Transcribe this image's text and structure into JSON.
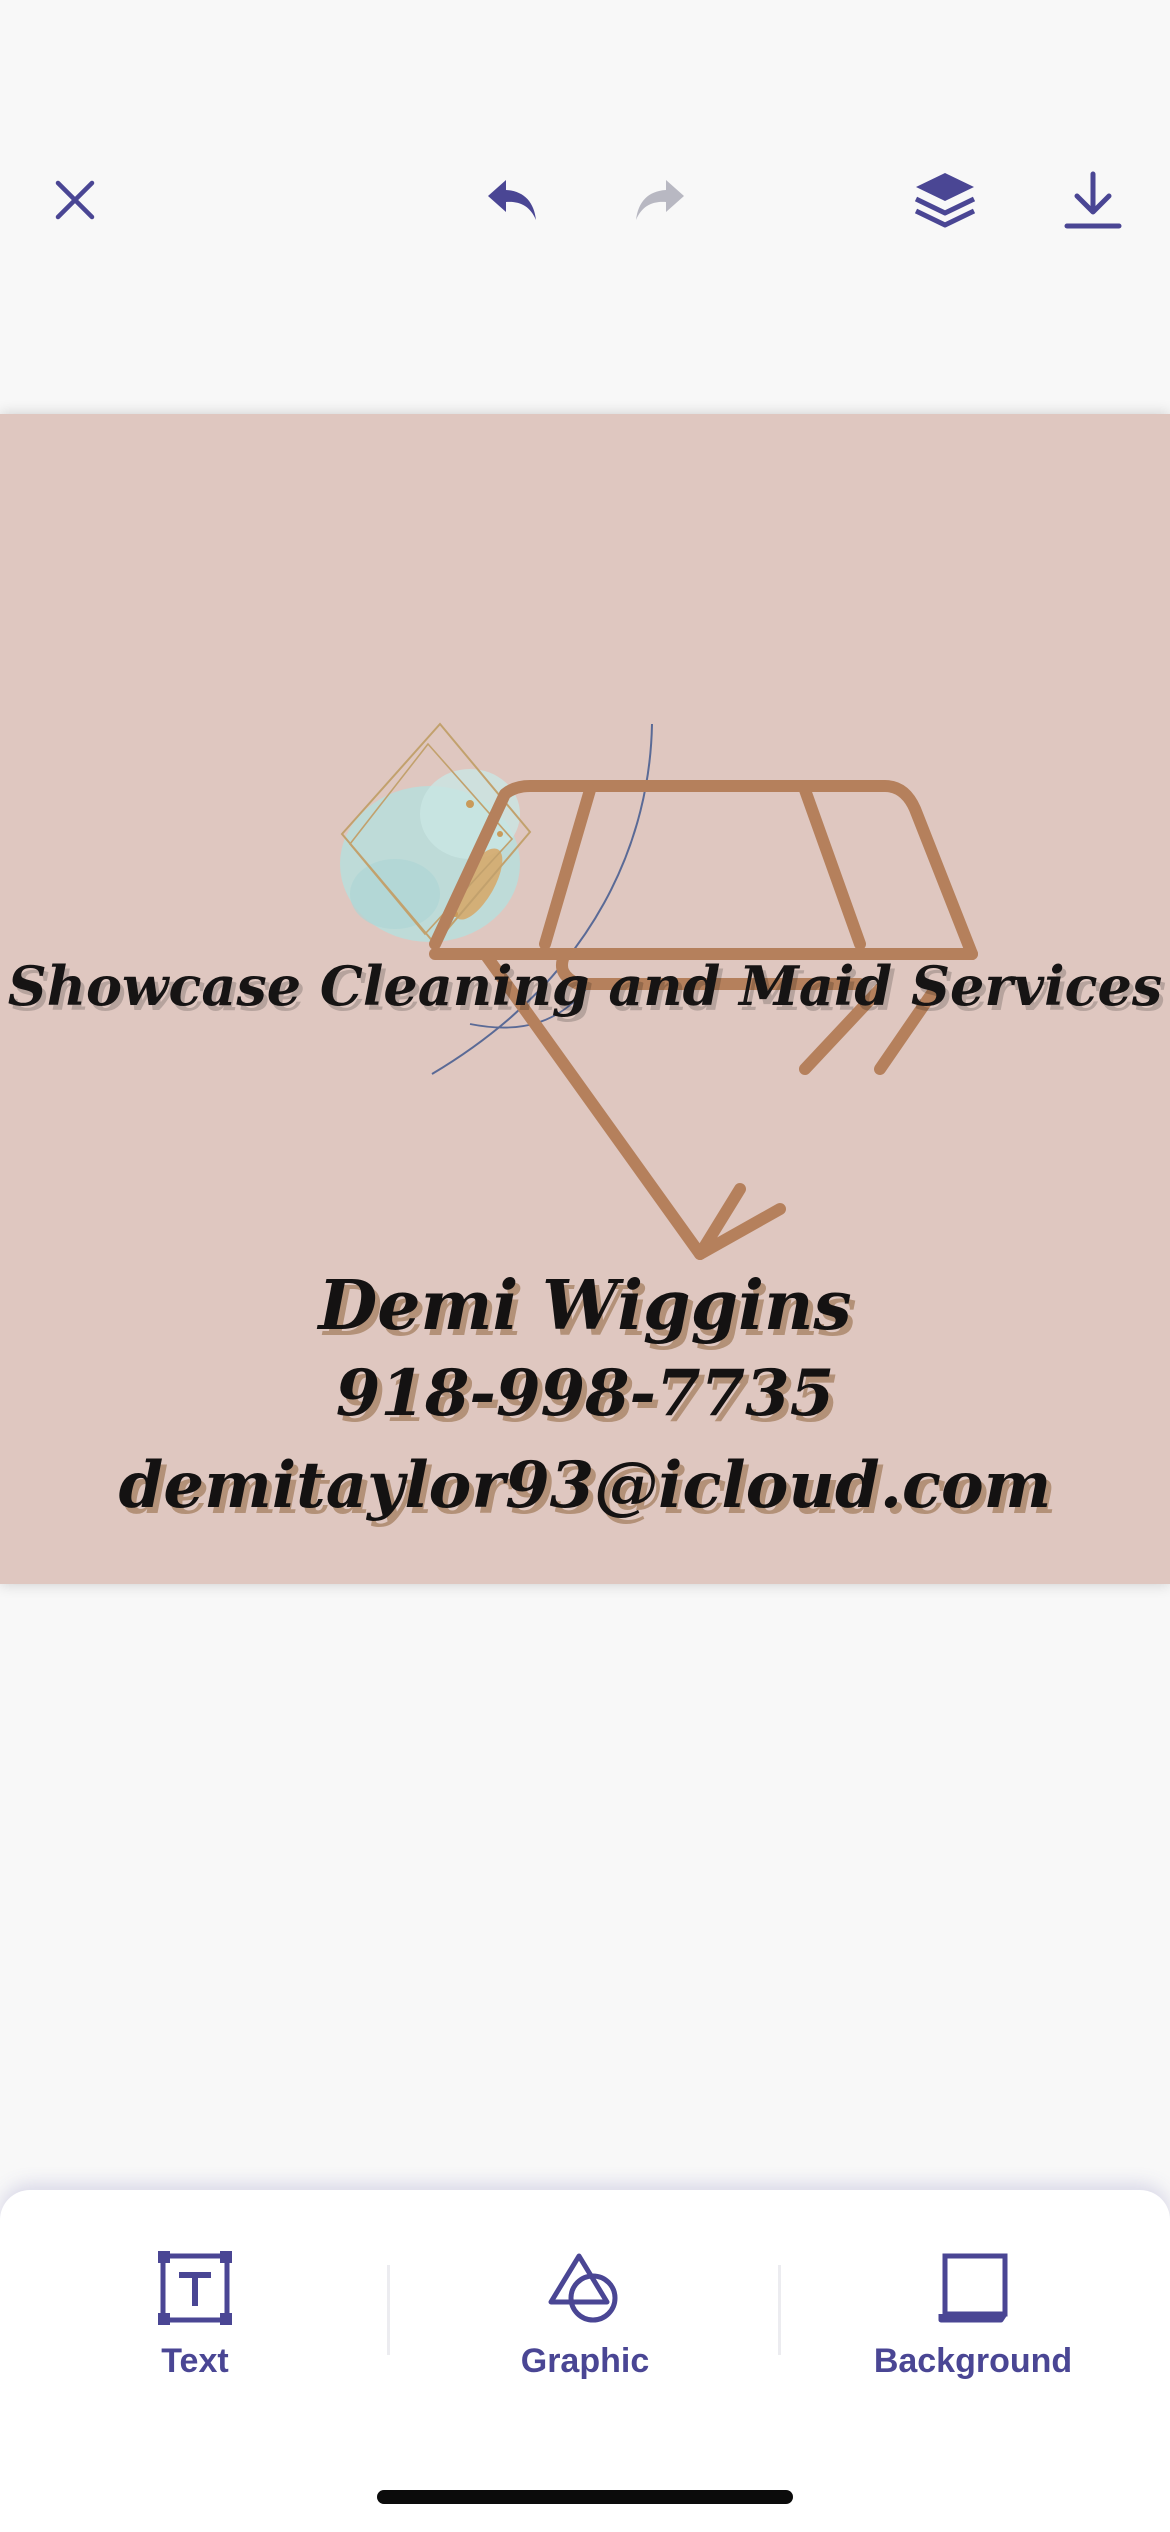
{
  "toolbar": {
    "close_icon": "close-icon",
    "undo_icon": "undo-icon",
    "redo_icon": "redo-icon",
    "layers_icon": "layers-icon",
    "download_icon": "download-icon",
    "accent_color": "#4a4694",
    "disabled_color": "#b8b8c2"
  },
  "card": {
    "background_color": "#dfc7c0",
    "title": "Showcase Cleaning and Maid Services",
    "name": "Demi Wiggins",
    "phone": "918-998-7735",
    "email": "demitaylor93@icloud.com",
    "logo": "diamond-logo-graphic"
  },
  "bottom_tools": [
    {
      "label": "Text",
      "icon": "text-tool-icon"
    },
    {
      "label": "Graphic",
      "icon": "shapes-icon"
    },
    {
      "label": "Background",
      "icon": "background-icon"
    }
  ]
}
